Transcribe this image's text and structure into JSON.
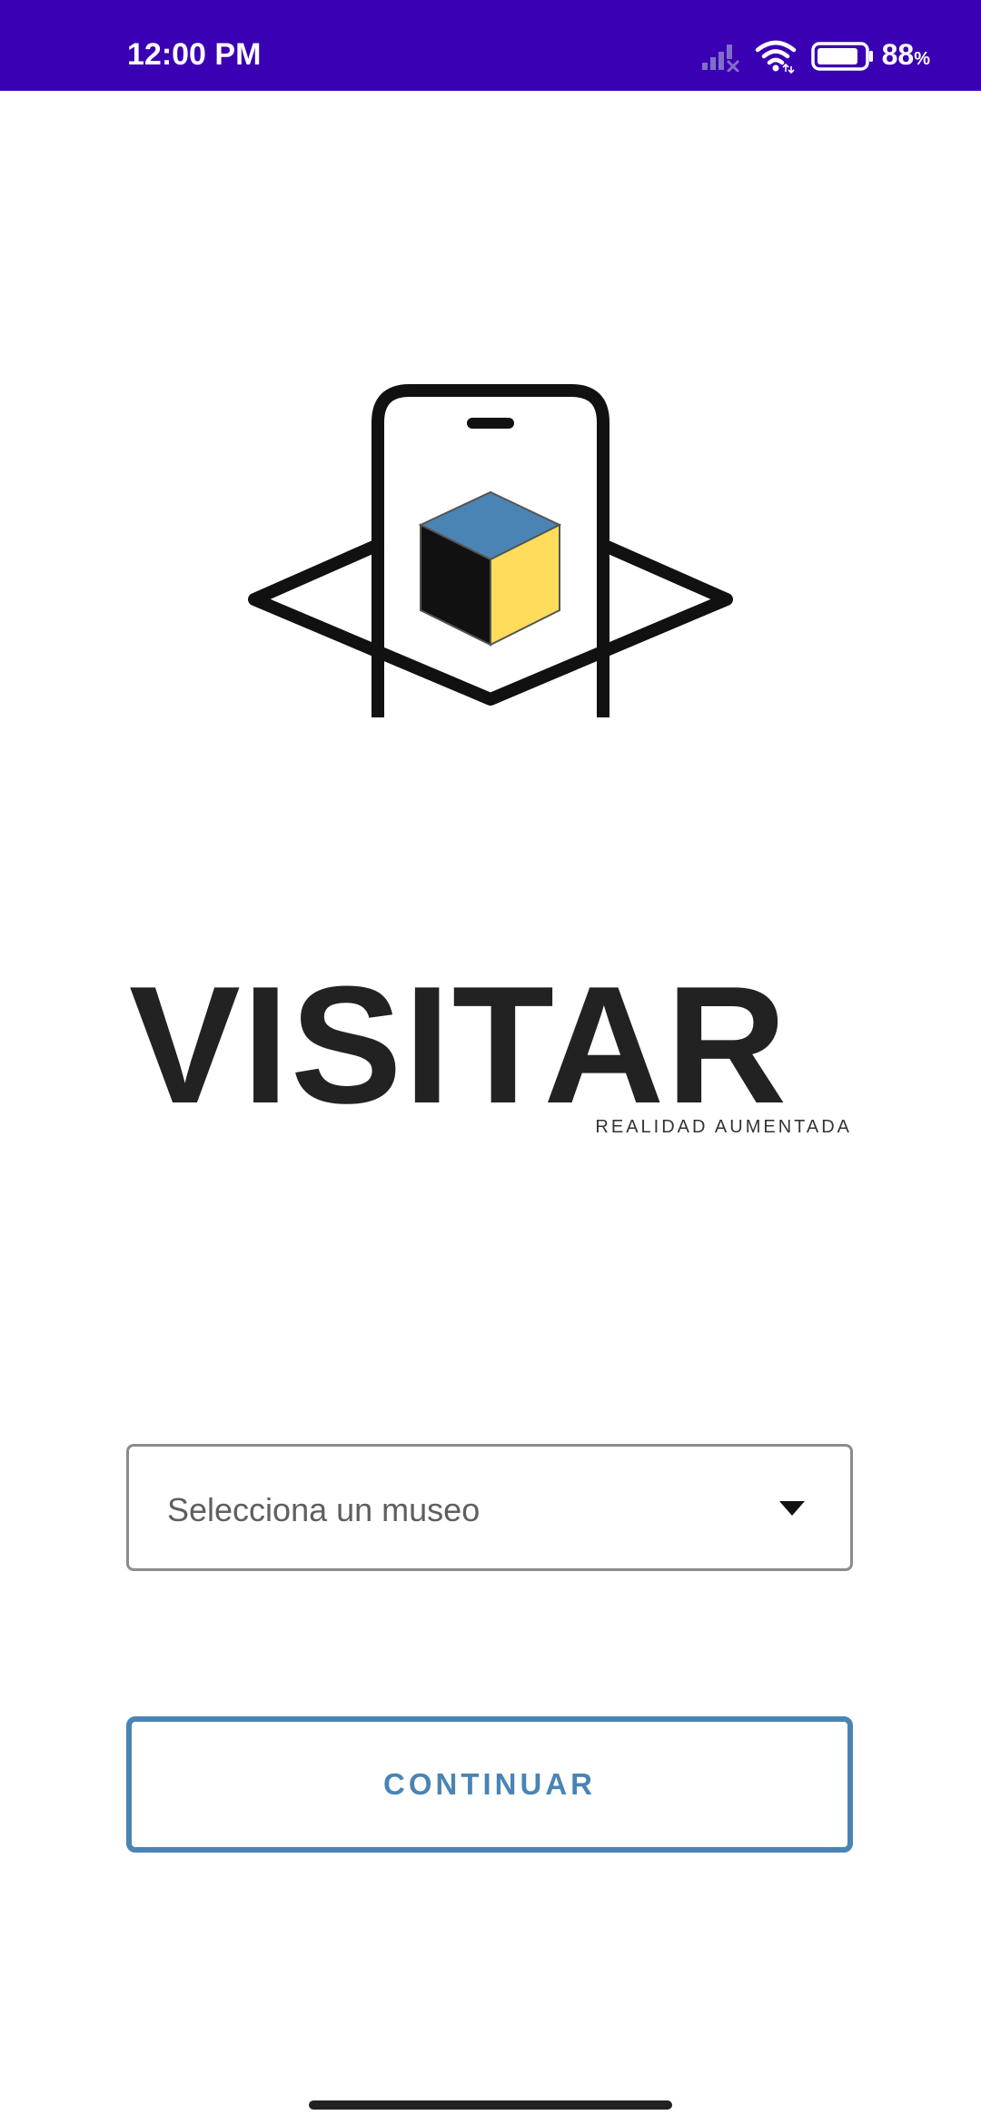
{
  "status_bar": {
    "time": "12:00 PM",
    "battery_percent": "88",
    "battery_unit": "%",
    "battery_level": 0.88,
    "background_color": "#3a00b4"
  },
  "logo": {
    "icon_name": "ar-phone-cube-icon",
    "cube_colors": {
      "top": "#4a84b4",
      "left": "#111111",
      "right": "#fedd5c"
    }
  },
  "brand": {
    "title_part1": "VISIT",
    "title_part2": "AR",
    "subtitle": "REALIDAD AUMENTADA"
  },
  "museum_select": {
    "placeholder": "Selecciona un museo",
    "icon": "dropdown-caret-icon"
  },
  "continue_button": {
    "label": "CONTINUAR",
    "accent_color": "#4a84b4"
  }
}
